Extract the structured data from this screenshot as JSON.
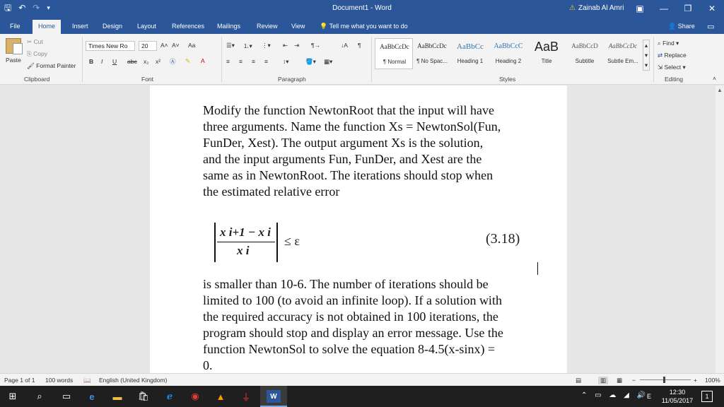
{
  "window": {
    "title": "Document1  -  Word",
    "user": "Zainab Al Amri",
    "minimize": "—",
    "restore": "❐",
    "close": "✕",
    "ribbon_display": "▣"
  },
  "tabs": [
    "File",
    "Home",
    "Insert",
    "Design",
    "Layout",
    "References",
    "Mailings",
    "Review",
    "View"
  ],
  "tell_me": "Tell me what you want to do",
  "share": "Share",
  "ribbon": {
    "clipboard": {
      "paste": "Paste",
      "cut": "Cut",
      "copy": "Copy",
      "format_painter": "Format Painter",
      "label": "Clipboard"
    },
    "font": {
      "name": "Times New Ro",
      "size": "20",
      "label": "Font",
      "bold": "B",
      "italic": "I",
      "underline": "U",
      "strike": "abc",
      "sub": "x₂",
      "sup": "x²",
      "grow": "A˄",
      "shrink": "A˅",
      "case": "Aa"
    },
    "paragraph": {
      "label": "Paragraph"
    },
    "styles": {
      "label": "Styles",
      "items": [
        {
          "preview": "AaBbCcDc",
          "name": "¶ Normal"
        },
        {
          "preview": "AaBbCcDc",
          "name": "¶ No Spac..."
        },
        {
          "preview": "AaBbCc",
          "name": "Heading 1"
        },
        {
          "preview": "AaBbCcC",
          "name": "Heading 2"
        },
        {
          "preview": "AaB",
          "name": "Title"
        },
        {
          "preview": "AaBbCcD",
          "name": "Subtitle"
        },
        {
          "preview": "AaBbCcDc",
          "name": "Subtle Em..."
        }
      ]
    },
    "editing": {
      "find": "Find",
      "replace": "Replace",
      "select": "Select",
      "label": "Editing"
    }
  },
  "document": {
    "para1": [
      "Modify the function NewtonRoot that the input will have",
      "three arguments. Name the function Xs = NewtonSol(Fun,",
      "FunDer, Xest). The output argument Xs is the solution,",
      "and the input arguments Fun, FunDer, and Xest are the",
      "same as in NewtonRoot. The iterations should stop when",
      "the estimated relative error"
    ],
    "equation": {
      "numerator": "x i+1 − x i",
      "denominator": "x i",
      "relation": "≤ ε",
      "number": "(3.18)"
    },
    "para2": [
      "is smaller than 10-6. The number of iterations should be",
      "limited to 100 (to avoid an infinite loop). If a solution with",
      "the required accuracy is not obtained in 100 iterations, the",
      "program should stop and display an error message. Use the",
      "function NewtonSol to solve the equation 8-4.5(x-sinx) =",
      "0."
    ]
  },
  "status": {
    "page": "Page 1 of 1",
    "words": "100 words",
    "language": "English (United Kingdom)",
    "zoom": "100%"
  },
  "taskbar": {
    "time": "12:30",
    "date": "11/05/2017",
    "lang": "E",
    "notifications": "1"
  },
  "colors": {
    "word_blue": "#2b579a",
    "taskbar": "#1f1f1f"
  }
}
